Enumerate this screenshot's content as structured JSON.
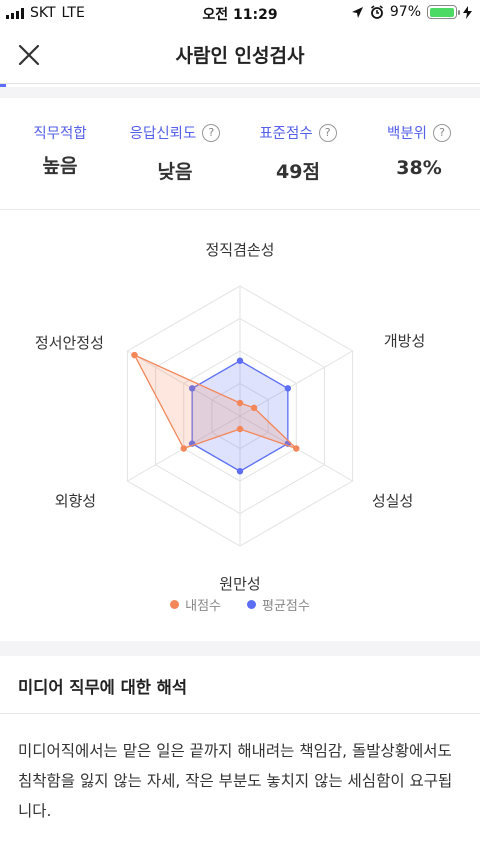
{
  "status_bar": {
    "carrier": "SKT",
    "network": "LTE",
    "time": "오전 11:29",
    "battery": "97%",
    "battery_level": 0.97
  },
  "header": {
    "title": "사람인 인성검사",
    "close_icon": "close-icon"
  },
  "summary": {
    "job_fit": {
      "label": "직무적합",
      "value": "높음"
    },
    "reliability": {
      "label": "응답신뢰도",
      "value": "낮음",
      "help_icon": "question-icon"
    },
    "standard_score": {
      "label": "표준점수",
      "value": "49점",
      "help_icon": "question-icon"
    },
    "percentile": {
      "label": "백분위",
      "value": "38%",
      "help_icon": "question-icon"
    }
  },
  "chart_data": {
    "type": "radar",
    "axes": [
      "정직겸손성",
      "개방성",
      "성실성",
      "원만성",
      "외향성",
      "정서안정성"
    ],
    "rmax": 4,
    "series": [
      {
        "name": "내점수",
        "color": "#f4875a",
        "values": [
          0.4,
          0.5,
          2.0,
          0.4,
          2.0,
          3.75
        ]
      },
      {
        "name": "평균점수",
        "color": "#5b6ef5",
        "values": [
          1.7,
          1.7,
          1.7,
          1.7,
          1.7,
          1.7
        ]
      }
    ],
    "grid_levels": 4
  },
  "legend": {
    "mine": "내점수",
    "avg": "평균점수"
  },
  "interpretation": {
    "title": "미디어 직무에 대한 해석",
    "body": "미디어직에서는 맡은 일은 끝까지 해내려는 책임감, 돌발상황에서도 침착함을 잃지 않는 자세, 작은 부분도 놓치지 않는 세심함이 요구됩니다."
  }
}
